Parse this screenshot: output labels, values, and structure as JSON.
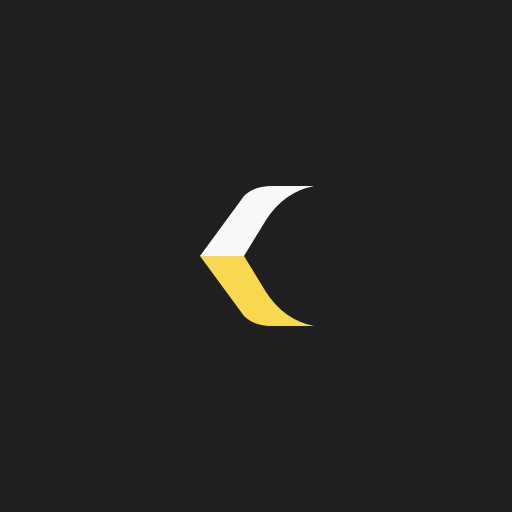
{
  "colors": {
    "background": "#1f1f1f",
    "upper_stroke": "#f8f8f8",
    "lower_stroke": "#f7d84e"
  },
  "logo": {
    "icon": "chevron-left-logo-icon"
  }
}
